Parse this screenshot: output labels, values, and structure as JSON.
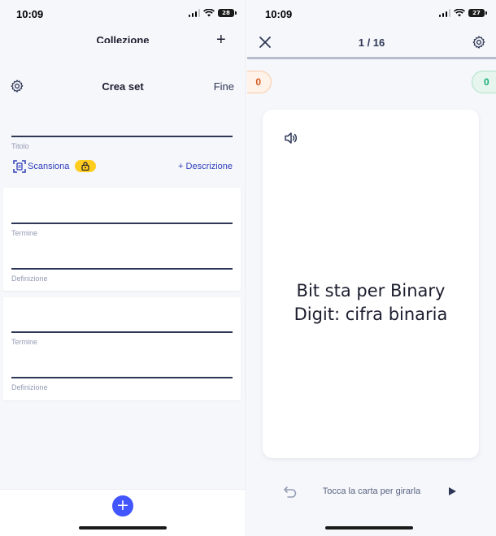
{
  "left_screen": {
    "status_time": "10:09",
    "battery_level": "28",
    "behind_header": {
      "title": "Collezione",
      "action_glyph": "+"
    },
    "header": {
      "title": "Crea set",
      "done_label": "Fine",
      "settings_icon": "gear-icon"
    },
    "title_field": {
      "label": "Titolo",
      "value": ""
    },
    "scan": {
      "label": "Scansiona",
      "scan_icon": "scan-document-icon",
      "lock_icon": "lock-icon"
    },
    "description_link": "+ Descrizione",
    "cards": [
      {
        "term_label": "Termine",
        "definition_label": "Definizione",
        "term_value": "",
        "definition_value": ""
      },
      {
        "term_label": "Termine",
        "definition_label": "Definizione",
        "term_value": "",
        "definition_value": ""
      }
    ],
    "add_button": {
      "glyph": "+",
      "icon": "plus-icon"
    }
  },
  "right_screen": {
    "status_time": "10:09",
    "battery_level": "27",
    "header": {
      "close_icon": "close-icon",
      "counter": "1 / 16",
      "settings_icon": "gear-icon"
    },
    "progress_fraction": 1,
    "scores": {
      "still_learning": "0",
      "known": "0"
    },
    "flashcard": {
      "audio_icon": "speaker-icon",
      "text": "Bit sta per Binary Digit: cifra binaria"
    },
    "bottom": {
      "undo_icon": "undo-icon",
      "hint": "Tocca la carta per girarla",
      "play_icon": "play-icon"
    }
  },
  "colors": {
    "accent": "#4255ff",
    "link": "#2e3db8",
    "lock_badge": "#ffcd1f",
    "score_orange": "#d4571d",
    "score_green": "#18ae79",
    "background": "#f6f7fb"
  }
}
